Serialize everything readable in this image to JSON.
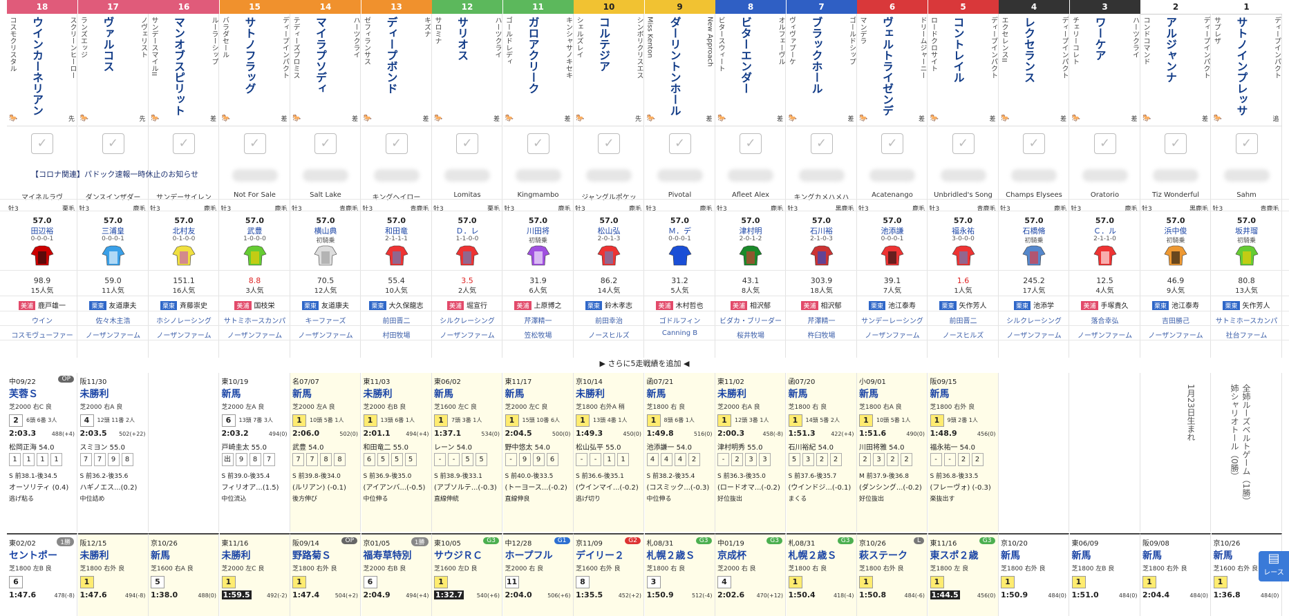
{
  "notice": "【コロナ関連】パドック速報一時休止のお知らせ",
  "more_label": "▶ さらに5走戦績を追加 ◀",
  "side_button": "レース",
  "horses": [
    {
      "gate": "18",
      "gate_color": "#e05b7a",
      "gate_fg": "#fff",
      "name": "ウインカーネリアン",
      "sire": "スクリーンヒーロー",
      "dam": "コスモクリスタル",
      "style": "先",
      "bms": "マイネルラヴ",
      "sex": "牡3",
      "coat": "栗毛",
      "weight": "57.0",
      "jockey": "田辺裕",
      "record": "0-0-0-1",
      "odds": "98.9",
      "odds_hot": false,
      "pop": "15人気",
      "trainer_tag": "美浦",
      "trainer": "鹿戸雄一",
      "owner": "ウイン",
      "breeder": "コスモヴューファー"
    },
    {
      "gate": "17",
      "gate_color": "#e05b7a",
      "gate_fg": "#fff",
      "name": "ヴァルコス",
      "sire": "ノヴェリスト",
      "dam": "ランズエッジ",
      "style": "先",
      "bms": "ダンスインザダー",
      "sex": "牡3",
      "coat": "鹿毛",
      "weight": "57.0",
      "jockey": "三浦皇",
      "record": "0-0-0-1",
      "odds": "59.0",
      "odds_hot": false,
      "pop": "11人気",
      "trainer_tag": "栗東",
      "trainer": "友道康夫",
      "owner": "佐々木主浩",
      "breeder": "ノーザンファーム"
    },
    {
      "gate": "16",
      "gate_color": "#e05b7a",
      "gate_fg": "#fff",
      "name": "マンオブスピリット",
      "sire": "ルーラーシップ",
      "dam": "サンデースマイルII",
      "style": "差",
      "bms": "サンデーサイレン",
      "sex": "牡3",
      "coat": "鹿毛",
      "weight": "57.0",
      "jockey": "北村友",
      "record": "0-1-0-0",
      "odds": "151.1",
      "odds_hot": false,
      "pop": "16人気",
      "trainer_tag": "栗東",
      "trainer": "斉藤崇史",
      "owner": "ホシノレーシング",
      "breeder": "ノーザンファーム"
    },
    {
      "gate": "15",
      "gate_color": "#f0912d",
      "gate_fg": "#fff",
      "name": "サトノフラッグ",
      "sire": "ディープインパクト",
      "dam": "バラダセール",
      "style": "差",
      "bms": "Not For Sale",
      "sex": "牡3",
      "coat": "鹿毛",
      "weight": "57.0",
      "jockey": "武豊",
      "record": "1-0-0-0",
      "odds": "8.8",
      "odds_hot": true,
      "pop": "3人気",
      "trainer_tag": "美浦",
      "trainer": "国枝栄",
      "owner": "サトミホースカンパ",
      "breeder": "ノーザンファーム"
    },
    {
      "gate": "14",
      "gate_color": "#f0912d",
      "gate_fg": "#fff",
      "name": "マイラプソディ",
      "sire": "ハーツクライ",
      "dam": "テディーズプロミス",
      "style": "差",
      "bms": "Salt Lake",
      "sex": "牡3",
      "coat": "青鹿毛",
      "weight": "57.0",
      "jockey": "横山典",
      "record": "初騎乗",
      "odds": "70.5",
      "odds_hot": false,
      "pop": "12人気",
      "trainer_tag": "栗東",
      "trainer": "友道康夫",
      "owner": "キーファーズ",
      "breeder": "ノーザンファーム"
    },
    {
      "gate": "13",
      "gate_color": "#f0912d",
      "gate_fg": "#fff",
      "name": "ディープボンド",
      "sire": "キズナ",
      "dam": "ゼフィランサス",
      "style": "差",
      "bms": "キングヘイロー",
      "sex": "牡3",
      "coat": "青鹿毛",
      "weight": "57.0",
      "jockey": "和田竜",
      "record": "2-1-1-1",
      "odds": "55.4",
      "odds_hot": false,
      "pop": "10人気",
      "trainer_tag": "栗東",
      "trainer": "大久保龍志",
      "owner": "前田晋二",
      "breeder": "村田牧場"
    },
    {
      "gate": "12",
      "gate_color": "#5cb85c",
      "gate_fg": "#fff",
      "name": "サリオス",
      "sire": "ハーツクライ",
      "dam": "サロミナ",
      "style": "差",
      "bms": "Lomitas",
      "sex": "牡3",
      "coat": "栗毛",
      "weight": "57.0",
      "jockey": "Ｄ．レ",
      "record": "1-1-0-0",
      "odds": "3.5",
      "odds_hot": true,
      "pop": "2人気",
      "trainer_tag": "美浦",
      "trainer": "堀宣行",
      "owner": "シルクレーシング",
      "breeder": "ノーザンファーム"
    },
    {
      "gate": "11",
      "gate_color": "#5cb85c",
      "gate_fg": "#fff",
      "name": "ガロアクリーク",
      "sire": "キンシャサノキセキ",
      "dam": "ゴールドレディ",
      "style": "差",
      "bms": "Kingmambo",
      "sex": "牡3",
      "coat": "鹿毛",
      "weight": "57.0",
      "jockey": "川田将",
      "record": "初騎乗",
      "odds": "31.9",
      "odds_hot": false,
      "pop": "6人気",
      "trainer_tag": "美浦",
      "trainer": "上原博之",
      "owner": "芹澤精一",
      "breeder": "笠松牧場"
    },
    {
      "gate": "10",
      "gate_color": "#f1c232",
      "gate_fg": "#222",
      "name": "コルテジア",
      "sire": "シンボリクリスエス",
      "dam": "シェルズレイ",
      "style": "先",
      "bms": "ジャングルポケッ",
      "sex": "牡3",
      "coat": "鹿毛",
      "weight": "57.0",
      "jockey": "松山弘",
      "record": "2-0-1-3",
      "odds": "86.2",
      "odds_hot": false,
      "pop": "14人気",
      "trainer_tag": "栗東",
      "trainer": "鈴木孝志",
      "owner": "前田幸治",
      "breeder": "ノースヒルズ"
    },
    {
      "gate": "9",
      "gate_color": "#f1c232",
      "gate_fg": "#222",
      "name": "ダーリントンホール",
      "sire": "New Approach",
      "dam": "Miss Kenton",
      "style": "差",
      "bms": "Pivotal",
      "sex": "牡3",
      "coat": "鹿毛",
      "weight": "57.0",
      "jockey": "Ｍ．デ",
      "record": "0-0-0-1",
      "odds": "31.2",
      "odds_hot": false,
      "pop": "5人気",
      "trainer_tag": "美浦",
      "trainer": "木村哲也",
      "owner": "ゴドルフィン",
      "breeder": "Canning B"
    },
    {
      "gate": "8",
      "gate_color": "#2f5fc4",
      "gate_fg": "#fff",
      "name": "ビターエンダー",
      "sire": "オルフェーヴル",
      "dam": "ビタースウィート",
      "style": "差",
      "bms": "Afleet Alex",
      "sex": "牡3",
      "coat": "鹿毛",
      "weight": "57.0",
      "jockey": "津村明",
      "record": "2-0-1-2",
      "odds": "43.1",
      "odds_hot": false,
      "pop": "8人気",
      "trainer_tag": "美浦",
      "trainer": "相沢郁",
      "owner": "ビダカ・ブリーダー",
      "breeder": "桜井牧場"
    },
    {
      "gate": "7",
      "gate_color": "#2f5fc4",
      "gate_fg": "#fff",
      "name": "ブラックホール",
      "sire": "ゴールドシップ",
      "dam": "ヴィヴァプーケ",
      "style": "差",
      "bms": "キングカメハメハ",
      "sex": "牡3",
      "coat": "黒鹿毛",
      "weight": "57.0",
      "jockey": "石川裕",
      "record": "2-1-0-3",
      "odds": "303.9",
      "odds_hot": false,
      "pop": "18人気",
      "trainer_tag": "美浦",
      "trainer": "相沢郁",
      "owner": "芹澤精一",
      "breeder": "杵臼牧場"
    },
    {
      "gate": "6",
      "gate_color": "#d9383a",
      "gate_fg": "#fff",
      "name": "ヴェルトライゼンデ",
      "sire": "ドリームジャーニー",
      "dam": "マンデラ",
      "style": "差",
      "bms": "Acatenango",
      "sex": "牡3",
      "coat": "鹿毛",
      "weight": "57.0",
      "jockey": "池添謙",
      "record": "0-0-0-1",
      "odds": "39.1",
      "odds_hot": false,
      "pop": "7人気",
      "trainer_tag": "栗東",
      "trainer": "池江泰寿",
      "owner": "サンデーレーシング",
      "breeder": "ノーザンファーム"
    },
    {
      "gate": "5",
      "gate_color": "#d9383a",
      "gate_fg": "#fff",
      "name": "コントレイル",
      "sire": "ディープインパクト",
      "dam": "ロードクロサイト",
      "style": "差",
      "bms": "Unbridled's Song",
      "sex": "牡3",
      "coat": "青鹿毛",
      "weight": "57.0",
      "jockey": "福永祐",
      "record": "3-0-0-0",
      "odds": "1.6",
      "odds_hot": true,
      "pop": "1人気",
      "trainer_tag": "栗東",
      "trainer": "矢作芳人",
      "owner": "前田晋二",
      "breeder": "ノースヒルズ"
    },
    {
      "gate": "4",
      "gate_color": "#333",
      "gate_fg": "#fff",
      "name": "レクセランス",
      "sire": "ディープインパクト",
      "dam": "エクセレンスII",
      "style": "差",
      "bms": "Champs Elysees",
      "sex": "牡3",
      "coat": "鹿毛",
      "weight": "57.0",
      "jockey": "石橋脩",
      "record": "初騎乗",
      "odds": "245.2",
      "odds_hot": false,
      "pop": "17人気",
      "trainer_tag": "栗東",
      "trainer": "池添学",
      "owner": "シルクレーシング",
      "breeder": "ノーザンファーム"
    },
    {
      "gate": "3",
      "gate_color": "#333",
      "gate_fg": "#fff",
      "name": "ワーケア",
      "sire": "ハーツクライ",
      "dam": "チェリーコレト",
      "style": "差",
      "bms": "Oratorio",
      "sex": "牡3",
      "coat": "鹿毛",
      "weight": "57.0",
      "jockey": "Ｃ．ル",
      "record": "2-1-1-0",
      "odds": "12.5",
      "odds_hot": false,
      "pop": "4人気",
      "trainer_tag": "美浦",
      "trainer": "手塚貴久",
      "owner": "落合幸弘",
      "breeder": "ノーザンファーム"
    },
    {
      "gate": "2",
      "gate_color": "#fff",
      "gate_fg": "#222",
      "name": "アルジャンナ",
      "sire": "ディープインパクト",
      "dam": "コンドコマンド",
      "style": "差",
      "bms": "Tiz Wonderful",
      "sex": "牡3",
      "coat": "黒鹿毛",
      "weight": "57.0",
      "jockey": "浜中俊",
      "record": "初騎乗",
      "odds": "46.9",
      "odds_hot": false,
      "pop": "9人気",
      "trainer_tag": "栗東",
      "trainer": "池江泰寿",
      "owner": "吉田勝己",
      "breeder": "ノーザンファーム"
    },
    {
      "gate": "1",
      "gate_color": "#fff",
      "gate_fg": "#222",
      "name": "サトノインプレッサ",
      "sire": "ディープインパクト",
      "dam": "サプレザ",
      "style": "追",
      "bms": "Sahm",
      "sex": "牡3",
      "coat": "青鹿毛",
      "weight": "57.0",
      "jockey": "坂井瑠",
      "record": "初騎乗",
      "odds": "80.8",
      "odds_hot": false,
      "pop": "13人気",
      "trainer_tag": "栗東",
      "trainer": "矢作芳人",
      "owner": "サトミホースカンパ",
      "breeder": "社台ファーム"
    }
  ],
  "past_row1": [
    {
      "date": "中09/22",
      "grade": "OP",
      "grade_color": "#666",
      "name": "芙蓉Ｓ",
      "cond": "芝2000 右C 良",
      "fin": "2",
      "field": "6頭 6番 3人",
      "time": "2:03.3",
      "bw": "488(+4)",
      "jock": "松岡正海 54.0",
      "pos": [
        "1",
        "1",
        "1",
        "1"
      ],
      "sp": "S 前38.1-後34.5",
      "winner": "オーソリティ (0.4)",
      "cm": "逃げ粘る",
      "y": false
    },
    {
      "date": "阪11/30",
      "grade": "",
      "grade_color": "",
      "name": "未勝利",
      "cond": "芝2000 右A 良",
      "fin": "4",
      "field": "12頭 11番 2人",
      "time": "2:03.5",
      "bw": "502(+22)",
      "jock": "スミヨン 55.0",
      "pos": [
        "7",
        "7",
        "9",
        "8"
      ],
      "sp": "S 前36.2-後35.6",
      "winner": "ハギノエス...(0.2)",
      "cm": "中位詰め",
      "y": false
    },
    null,
    {
      "date": "東10/19",
      "grade": "",
      "grade_color": "",
      "name": "新馬",
      "cond": "芝2000 左A 良",
      "fin": "6",
      "field": "13頭 7番 3人",
      "time": "2:03.2",
      "bw": "494(0)",
      "jock": "戸崎圭太 55.0",
      "pos": [
        "出",
        "9",
        "8",
        "7"
      ],
      "sp": "S 前39.0-後35.4",
      "winner": "フィリオア...(1.5)",
      "cm": "中位流込",
      "y": false
    },
    {
      "date": "名07/07",
      "grade": "",
      "grade_color": "",
      "name": "新馬",
      "cond": "芝2000 左A 良",
      "fin": "1",
      "field": "10頭 5番 1人",
      "time": "2:06.0",
      "bw": "502(0)",
      "jock": "武豊 54.0",
      "pos": [
        "7",
        "7",
        "8",
        "8"
      ],
      "sp": "S 前39.8-後34.0",
      "winner": "(ルリアン) (-0.1)",
      "cm": "後方伸び",
      "y": true
    },
    {
      "date": "東11/03",
      "grade": "",
      "grade_color": "",
      "name": "未勝利",
      "cond": "芝2000 右B 良",
      "fin": "1",
      "field": "13頭 6番 1人",
      "time": "2:01.1",
      "bw": "494(+4)",
      "jock": "和田竜二 55.0",
      "pos": [
        "6",
        "5",
        "5",
        "5"
      ],
      "sp": "S 前36.9-後35.0",
      "winner": "(アイアンバ...(-0.5)",
      "cm": "中位伸る",
      "y": true
    },
    {
      "date": "東06/02",
      "grade": "",
      "grade_color": "",
      "name": "新馬",
      "cond": "芝1600 左C 良",
      "fin": "1",
      "field": "7頭 3番 1人",
      "time": "1:37.1",
      "bw": "534(0)",
      "jock": "レーン 54.0",
      "pos": [
        "-",
        "-",
        "5",
        "5"
      ],
      "sp": "S 前38.9-後33.1",
      "winner": "(アブソルテ...(-0.3)",
      "cm": "直線伸統",
      "y": true
    },
    {
      "date": "東11/17",
      "grade": "",
      "grade_color": "",
      "name": "新馬",
      "cond": "芝2000 左C 良",
      "fin": "1",
      "field": "15頭 10番 6人",
      "time": "2:04.5",
      "bw": "500(0)",
      "jock": "野中悠太 54.0",
      "pos": [
        "-",
        "9",
        "9",
        "6"
      ],
      "sp": "S 前40.0-後33.5",
      "winner": "(トーヨース...(-0.2)",
      "cm": "直線伸良",
      "y": true
    },
    {
      "date": "京10/14",
      "grade": "",
      "grade_color": "",
      "name": "未勝利",
      "cond": "芝1800 右外A 稍",
      "fin": "1",
      "field": "13頭 4番 1人",
      "time": "1:49.3",
      "bw": "450(0)",
      "jock": "松山弘平 55.0",
      "pos": [
        "-",
        "-",
        "1",
        "1"
      ],
      "sp": "S 前36.6-後35.1",
      "winner": "(ウインマイ...(-0.2)",
      "cm": "逃げ切り",
      "y": true
    },
    {
      "date": "函07/21",
      "grade": "",
      "grade_color": "",
      "name": "新馬",
      "cond": "芝1800 右 良",
      "fin": "1",
      "field": "8頭 6番 1人",
      "time": "1:49.8",
      "bw": "516(0)",
      "jock": "池添謙一 54.0",
      "pos": [
        "4",
        "4",
        "4",
        "2"
      ],
      "sp": "S 前38.2-後35.4",
      "winner": "(コスミック...(-0.3)",
      "cm": "中位伸る",
      "y": true
    },
    {
      "date": "東11/02",
      "grade": "",
      "grade_color": "",
      "name": "未勝利",
      "cond": "芝2000 右A 良",
      "fin": "1",
      "field": "12頭 3番 1人",
      "time": "2:00.3",
      "bw": "458(-8)",
      "jock": "津村明秀 55.0",
      "pos": [
        "-",
        "2",
        "3",
        "3"
      ],
      "sp": "S 前36.3-後35.0",
      "winner": "(ロードオマ...(-0.2)",
      "cm": "好位抜出",
      "y": true
    },
    {
      "date": "函07/20",
      "grade": "",
      "grade_color": "",
      "name": "新馬",
      "cond": "芝1800 右 良",
      "fin": "1",
      "field": "14頭 5番 2人",
      "time": "1:51.3",
      "bw": "422(+4)",
      "jock": "石川裕紀 54.0",
      "pos": [
        "5",
        "3",
        "2",
        "2"
      ],
      "sp": "S 前37.6-後35.7",
      "winner": "(ウインドジ...(-0.1)",
      "cm": "まくる",
      "y": true
    },
    {
      "date": "小09/01",
      "grade": "",
      "grade_color": "",
      "name": "新馬",
      "cond": "芝1800 右A 良",
      "fin": "1",
      "field": "10頭 5番 1人",
      "time": "1:51.6",
      "bw": "490(0)",
      "jock": "川田将雅 54.0",
      "pos": [
        "2",
        "3",
        "2",
        "2"
      ],
      "sp": "M 前37.9-後36.8",
      "winner": "(ダンシング...(-0.2)",
      "cm": "好位抜出",
      "y": true
    },
    {
      "date": "阪09/15",
      "grade": "",
      "grade_color": "",
      "name": "新馬",
      "cond": "芝1800 右外 良",
      "fin": "1",
      "field": "9頭 2番 1人",
      "time": "1:48.9",
      "bw": "456(0)",
      "jock": "福永祐一 54.0",
      "pos": [
        "-",
        "-",
        "2",
        "2"
      ],
      "sp": "S 前36.8-後33.5",
      "winner": "(フレーヴォ) (-0.3)",
      "cm": "楽抜出す",
      "y": true
    },
    null,
    null,
    null,
    null
  ],
  "notes": [
    "1月23日生まれ",
    "全姉ルーズベルトゲーム（1勝）",
    "姉シャリオトール（0勝）"
  ],
  "past_row2": [
    {
      "date": "東02/02",
      "grade": "1勝",
      "grade_color": "#888",
      "name": "セントポー",
      "cond": "芝1800 左B 良",
      "fin": "6",
      "time": "1:47.6",
      "bw": "478(-8)",
      "dark": false
    },
    {
      "date": "阪12/15",
      "grade": "",
      "grade_color": "",
      "name": "未勝利",
      "cond": "芝1800 右外 良",
      "fin": "1",
      "time": "1:47.6",
      "bw": "494(-8)",
      "dark": false
    },
    {
      "date": "京10/26",
      "grade": "",
      "grade_color": "",
      "name": "新馬",
      "cond": "芝1600 右A 良",
      "fin": "5",
      "time": "1:38.0",
      "bw": "488(0)",
      "dark": false
    },
    {
      "date": "東11/16",
      "grade": "",
      "grade_color": "",
      "name": "未勝利",
      "cond": "芝2000 左C 良",
      "fin": "1",
      "time": "1:59.5",
      "bw": "492(-2)",
      "dark": true
    },
    {
      "date": "阪09/14",
      "grade": "OP",
      "grade_color": "#666",
      "name": "野路菊Ｓ",
      "cond": "芝1800 右外 良",
      "fin": "1",
      "time": "1:47.4",
      "bw": "504(+2)",
      "dark": false
    },
    {
      "date": "京01/05",
      "grade": "1勝",
      "grade_color": "#888",
      "name": "福寿草特別",
      "cond": "芝2000 右B 良",
      "fin": "6",
      "time": "2:04.9",
      "bw": "494(+4)",
      "dark": false
    },
    {
      "date": "東10/05",
      "grade": "G3",
      "grade_color": "#4caf50",
      "name": "サウジＲＣ",
      "cond": "芝1600 左D 良",
      "fin": "1",
      "time": "1:32.7",
      "bw": "540(+6)",
      "dark": true
    },
    {
      "date": "中12/28",
      "grade": "G1",
      "grade_color": "#2d6fd1",
      "name": "ホープフル",
      "cond": "芝2000 右 良",
      "fin": "11",
      "time": "2:04.0",
      "bw": "506(+6)",
      "dark": false
    },
    {
      "date": "京11/09",
      "grade": "G2",
      "grade_color": "#d33",
      "name": "デイリー２",
      "cond": "芝1600 右外 良",
      "fin": "8",
      "time": "1:35.5",
      "bw": "452(+2)",
      "dark": false
    },
    {
      "date": "札08/31",
      "grade": "G3",
      "grade_color": "#4caf50",
      "name": "札幌２歳Ｓ",
      "cond": "芝1800 右 良",
      "fin": "3",
      "time": "1:50.9",
      "bw": "512(-4)",
      "dark": false
    },
    {
      "date": "中01/19",
      "grade": "G3",
      "grade_color": "#4caf50",
      "name": "京成杯",
      "cond": "芝2000 右 良",
      "fin": "4",
      "time": "2:02.6",
      "bw": "470(+12)",
      "dark": false
    },
    {
      "date": "札08/31",
      "grade": "G3",
      "grade_color": "#4caf50",
      "name": "札幌２歳Ｓ",
      "cond": "芝1800 右 良",
      "fin": "1",
      "time": "1:50.4",
      "bw": "418(-4)",
      "dark": false
    },
    {
      "date": "京10/26",
      "grade": "L",
      "grade_color": "#777",
      "name": "萩ステーク",
      "cond": "芝1800 右外 良",
      "fin": "1",
      "time": "1:50.8",
      "bw": "484(-6)",
      "dark": false
    },
    {
      "date": "東11/16",
      "grade": "G3",
      "grade_color": "#4caf50",
      "name": "東スポ２歳",
      "cond": "芝1800 左 良",
      "fin": "1",
      "time": "1:44.5",
      "bw": "456(0)",
      "dark": true
    },
    {
      "date": "京10/20",
      "grade": "",
      "grade_color": "",
      "name": "新馬",
      "cond": "芝1800 右外 良",
      "fin": "1",
      "time": "1:50.9",
      "bw": "484(0)",
      "dark": false
    },
    {
      "date": "東06/09",
      "grade": "",
      "grade_color": "",
      "name": "新馬",
      "cond": "芝1800 左B 良",
      "fin": "1",
      "time": "1:51.0",
      "bw": "484(0)",
      "dark": false
    },
    {
      "date": "阪09/08",
      "grade": "",
      "grade_color": "",
      "name": "新馬",
      "cond": "芝1800 右外 良",
      "fin": "1",
      "time": "2:04.4",
      "bw": "484(0)",
      "dark": false
    },
    {
      "date": "京10/26",
      "grade": "",
      "grade_color": "",
      "name": "新馬",
      "cond": "芝1600 右外 良",
      "fin": "1",
      "time": "1:36.8",
      "bw": "484(0)",
      "dark": false
    }
  ]
}
